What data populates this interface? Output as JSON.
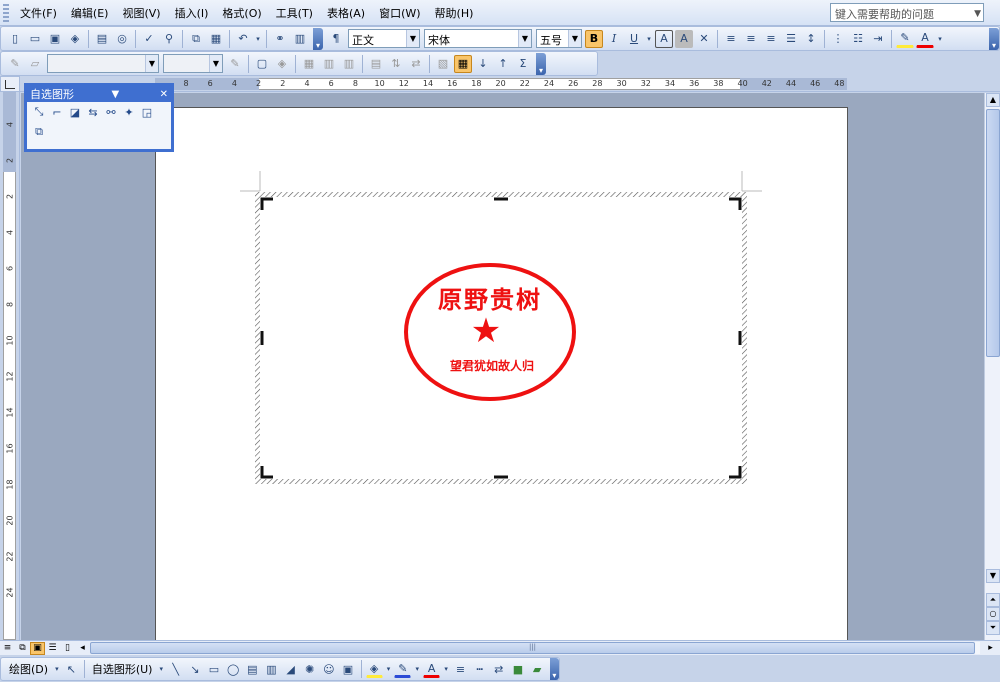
{
  "menu": {
    "items": [
      "文件(F)",
      "编辑(E)",
      "视图(V)",
      "插入(I)",
      "格式(O)",
      "工具(T)",
      "表格(A)",
      "窗口(W)",
      "帮助(H)"
    ],
    "help_placeholder": "键入需要帮助的问题"
  },
  "formatting": {
    "style": "正文",
    "font": "宋体",
    "size": "五号",
    "bold": "B",
    "italic": "I",
    "underline": "U",
    "font_color_glyph": "A",
    "sum_glyph": "Σ"
  },
  "ruler": {
    "h_ticks": [
      "8",
      "6",
      "4",
      "2",
      "2",
      "4",
      "6",
      "8",
      "10",
      "12",
      "14",
      "16",
      "18",
      "20",
      "22",
      "24",
      "26",
      "28",
      "30",
      "32",
      "34",
      "36",
      "38",
      "40",
      "42",
      "44",
      "46",
      "48"
    ],
    "v_ticks": [
      "4",
      "2",
      "2",
      "4",
      "6",
      "8",
      "10",
      "12",
      "14",
      "16",
      "18",
      "20",
      "22",
      "24"
    ]
  },
  "palette": {
    "title": "自选图形",
    "icons": [
      "lines-icon",
      "connectors-icon",
      "basic-shapes-icon",
      "block-arrows-icon",
      "flowchart-icon",
      "stars-banners-icon",
      "callouts-icon",
      "more-autoshapes-icon"
    ]
  },
  "stamp": {
    "name": "原野贵树",
    "star": "★",
    "motto": "望君犹如故人归",
    "color": "#ee1111"
  },
  "drawbar": {
    "draw_label": "绘图(D)",
    "autoshapes_label": "自选图形(U)"
  }
}
